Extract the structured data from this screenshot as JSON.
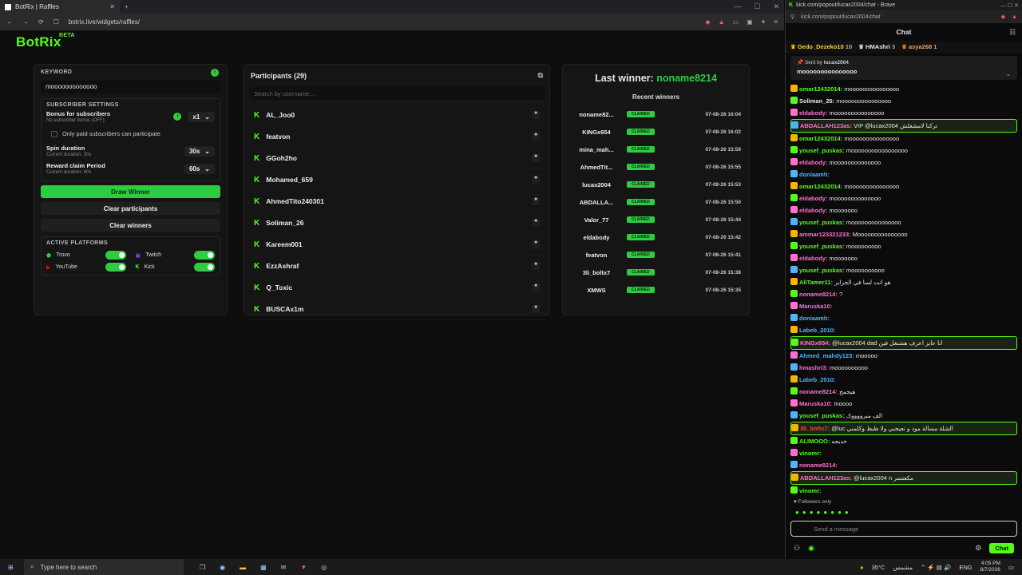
{
  "browser_left": {
    "tab_title": "BotRix | Raffles",
    "url": "botrix.live/widgets/raffles/"
  },
  "app": {
    "logo": "BotRix",
    "logo_tag": "BETA"
  },
  "settings": {
    "keyword_label": "KEYWORD",
    "keyword_value": "mooooooooooooo",
    "info_badge": "i",
    "subscriber_settings_label": "SUBSCRIBER SETTINGS",
    "bonus_title": "Bonus for subscribers",
    "bonus_sub": "No subscriber bonus (OFF)",
    "bonus_select": "x1",
    "only_paid_label": "Only paid subscribers can participate",
    "spin_title": "Spin duration",
    "spin_sub": "Current duration: 30s",
    "spin_select": "30s",
    "reward_title": "Reward claim Period",
    "reward_sub": "Current duration: 60s",
    "reward_select": "60s",
    "draw_winner": "Draw Winner",
    "clear_participants": "Clear participants",
    "clear_winners": "Clear winners",
    "active_platforms_label": "ACTIVE PLATFORMS",
    "platforms": [
      {
        "name": "Trovo",
        "enabled": true
      },
      {
        "name": "Twitch",
        "enabled": true
      },
      {
        "name": "YouTube",
        "enabled": true
      },
      {
        "name": "Kick",
        "enabled": true
      }
    ]
  },
  "participants": {
    "title": "Participants (29)",
    "search_placeholder": "Search by username...",
    "list": [
      "AL_Joo0",
      "featvon",
      "GGoh2ho",
      "Mohamed_659",
      "AhmedTito240301",
      "Soliman_26",
      "Kareem001",
      "EzzAshraf",
      "Q_Toxic",
      "BUSCAx1m"
    ]
  },
  "winners": {
    "last_label": "Last winner:",
    "last_name": "noname8214",
    "recent_label": "Recent winners",
    "claimed_label": "CLAIMED",
    "list": [
      {
        "name": "noname82...",
        "date": "07-08-26 16:04"
      },
      {
        "name": "KINGx654",
        "date": "07-08-26 16:02"
      },
      {
        "name": "mina_mah...",
        "date": "07-08-26 15:59"
      },
      {
        "name": "AhmedTit...",
        "date": "07-08-26 15:55"
      },
      {
        "name": "lucax2004",
        "date": "07-08-26 15:53"
      },
      {
        "name": "ABDALLA...",
        "date": "07-08-26 15:50"
      },
      {
        "name": "Valor_77",
        "date": "07-08-26 15:44"
      },
      {
        "name": "eldabody",
        "date": "07-08-26 15:42"
      },
      {
        "name": "featvon",
        "date": "07-08-26 15:41"
      },
      {
        "name": "3li_boltx7",
        "date": "07-08-26 15:38"
      },
      {
        "name": "XMWS",
        "date": "07-08-26 15:35"
      }
    ]
  },
  "browser_right": {
    "tab_title": "kick.com/popout/lucax2004/chat - Brave",
    "url": "kick.com/popout/lucax2004/chat"
  },
  "chat": {
    "title": "Chat",
    "gifters": [
      {
        "name": "Gedo_Dezeko10",
        "count": "10"
      },
      {
        "name": "HMAshri",
        "count": "3"
      },
      {
        "name": "asya268",
        "count": "1"
      }
    ],
    "pinned_by": "Sent by",
    "pinned_user": "lucax2004",
    "pinned_msg": "mooooooooooooooo",
    "messages": [
      {
        "user": "omar12432014:",
        "text": "mooooooooooooooo",
        "color": "#53fc18",
        "hl": false
      },
      {
        "user": "Soliman_26:",
        "text": "mooooooooooooooo",
        "color": "#e6e6e6",
        "hl": false
      },
      {
        "user": "eldabody:",
        "text": "mooooooooooooooo",
        "color": "#ff6fd1",
        "hl": false
      },
      {
        "user": "ABDALLAH123as:",
        "text": "VIP @lucax2004 تركنا لامشغلش",
        "color": "#ff6fd1",
        "hl": true
      },
      {
        "user": "omar12432014:",
        "text": "mooooooooooooooo",
        "color": "#53fc18",
        "hl": false
      },
      {
        "user": "yousef_puskas:",
        "text": "mooooooooooooooooo",
        "color": "#53fc18",
        "hl": false
      },
      {
        "user": "eldabody:",
        "text": "moooooooooooooo",
        "color": "#ff6fd1",
        "hl": false
      },
      {
        "user": "doniaamh:",
        "text": "",
        "color": "#4fb3ff",
        "hl": false
      },
      {
        "user": "omar12432014:",
        "text": "mooooooooooooooo",
        "color": "#53fc18",
        "hl": false
      },
      {
        "user": "eldabody:",
        "text": "moooooooooooooo",
        "color": "#ff6fd1",
        "hl": false
      },
      {
        "user": "eldabody:",
        "text": "mooooooo",
        "color": "#ff6fd1",
        "hl": false
      },
      {
        "user": "yousef_puskas:",
        "text": "mooooooooooooooo",
        "color": "#53fc18",
        "hl": false
      },
      {
        "user": "ammar123321233:",
        "text": "Mooooooooooooooo",
        "color": "#ff6fd1",
        "hl": false
      },
      {
        "user": "yousef_puskas:",
        "text": "mooooooooo",
        "color": "#53fc18",
        "hl": false
      },
      {
        "user": "eldabody:",
        "text": "mooooooo",
        "color": "#ff6fd1",
        "hl": false
      },
      {
        "user": "yousef_puskas:",
        "text": "moooooooooo",
        "color": "#53fc18",
        "hl": false
      },
      {
        "user": "AliTamer11:",
        "text": "هو انت لسا في الجزاير",
        "color": "#53fc18",
        "hl": false
      },
      {
        "user": "noname8214:",
        "text": "?",
        "color": "#ff6fd1",
        "hl": false
      },
      {
        "user": "Maruska10:",
        "text": "",
        "color": "#ff6fd1",
        "hl": false
      },
      {
        "user": "doniaamh:",
        "text": "",
        "color": "#4fb3ff",
        "hl": false
      },
      {
        "user": "Labeb_2010:",
        "text": "",
        "color": "#4fb3ff",
        "hl": false
      },
      {
        "user": "KINGx654:",
        "text": "@lucax2004 dad انا عايز اعرف هشتغل فين",
        "color": "#ff6fd1",
        "hl": true
      },
      {
        "user": "Ahmed_mahdy123:",
        "text": "mooooo",
        "color": "#4fb3ff",
        "hl": false
      },
      {
        "user": "hmashri3:",
        "text": "moooooooooo",
        "color": "#ff6fd1",
        "hl": false
      },
      {
        "user": "Labeb_2010:",
        "text": "",
        "color": "#4fb3ff",
        "hl": false
      },
      {
        "user": "noname8214:",
        "text": "هيجمج",
        "color": "#ff6fd1",
        "hl": false
      },
      {
        "user": "Maruska10:",
        "text": "moooo",
        "color": "#ff6fd1",
        "hl": false
      },
      {
        "user": "yousef_puskas:",
        "text": "الف مبرووووك",
        "color": "#53fc18",
        "hl": false
      },
      {
        "user": "3li_boltx7:",
        "text": "@luc الشلة مسالة مود و تعيجني ولا ظبط وكلمني",
        "color": "#ff4040",
        "hl": true
      },
      {
        "user": "ALIMOOO:",
        "text": "خديجه",
        "color": "#53fc18",
        "hl": false
      },
      {
        "user": "vinomr:",
        "text": "",
        "color": "#53fc18",
        "hl": false
      },
      {
        "user": "noname8214:",
        "text": "",
        "color": "#ff6fd1",
        "hl": false
      },
      {
        "user": "ABDALLAH123as:",
        "text": "@lucax2004 n مكعنتمر",
        "color": "#ff6fd1",
        "hl": true
      },
      {
        "user": "vinomr:",
        "text": "",
        "color": "#53fc18",
        "hl": false
      }
    ],
    "followers_only": "Followers only",
    "send_placeholder": "Send a message",
    "chat_button": "Chat"
  },
  "taskbar": {
    "search_placeholder": "Type here to search",
    "weather": "35°C",
    "weather_label": "مشمس",
    "lang": "ENG",
    "time": "4:05 PM",
    "date": "8/7/2026"
  },
  "colors": {
    "kick_green": "#53fc18",
    "botrix_green": "#2ecc40"
  }
}
